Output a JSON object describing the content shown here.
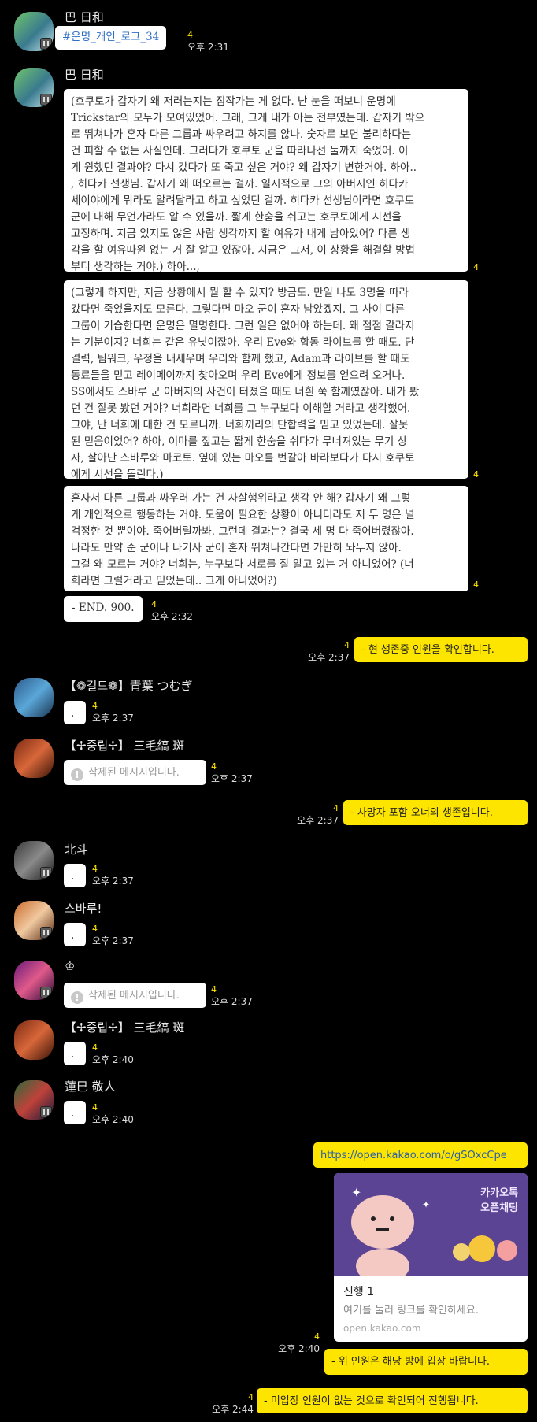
{
  "unread_count": "4",
  "colors": {
    "background": "#000000",
    "mine_bubble": "#fee500",
    "other_bubble": "#ffffff",
    "link": "#2f70c5"
  },
  "messages": [
    {
      "sender": "巴 日和",
      "text": "#운명_개인_로그_34",
      "time": "오후 2:31"
    },
    {
      "sender": "巴 日和",
      "p1_lines": [
        "(호쿠토가 갑자기 왜 저러는지는 짐작가는 게 없다. 난 눈을 떠보니 운명에",
        "Trickstar의 모두가 모여있었어. 그래, 그게 내가 아는 전부였는데. 갑자기 밖으",
        "로 뛰쳐나가 혼자 다른 그룹과 싸우려고 하지를 않나. 숫자로 보면 불리하다는",
        "건 피할 수 없는 사실인데. 그러다가 호쿠토 군을 따라나선 둘까지 죽었어. 이",
        "게 원했던 결과야? 다시 갔다가 또 죽고 싶은 거야? 왜 갑자기 변한거야. 하아..",
        ", 히다카 선생님. 갑자기 왜 떠오르는 걸까. 일시적으로 그의 아버지인 히다카",
        "세이야에게 뭐라도 알려달라고 하고 싶었던 걸까. 히다카 선생님이라면 호쿠토",
        " 군에 대해 무언가라도 알 수 있을까. 짧게 한숨을 쉬고는 호쿠토에게 시선을",
        "고정하며. 지금 있지도 않은 사람 생각까지 할 여유가 내게 남아있어? 다른 생",
        "각을 할 여유따윈 없는 거 잘 알고 있잖아. 지금은 그저, 이 상황을 해결할 방법",
        "부터 생각하는 거야.) 하아...,"
      ],
      "p2_lines": [
        "(그렇게 하지만, 지금 상황에서 뭘 할 수 있지? 방금도. 만일 나도 3명을 따라",
        "갔다면 죽었을지도 모른다. 그렇다면 마오 군이 혼자 남았겠지. 그 사이 다른",
        "그룹이 기습한다면 운명은 멸명한다. 그런 일은 없어야 하는데. 왜 점점 갈라지",
        "는 기분이지? 너희는 같은 유닛이잖아. 우리 Eve와 합동 라이브를 할 때도. 단",
        "결력, 팀워크, 우정을 내세우며 우리와 함께 했고, Adam과 라이브를 할 때도",
        "동료들을 믿고 레이메이까지 찾아오며 우리 Eve에게 정보를 얻으려 오거나.",
        "SS에서도 스바루 군 아버지의 사건이 터졌을 때도 너흰 쭉 함께였잖아. 내가 봤",
        "던 건 잘못 봤던 거야? 너희라면 너희를 그 누구보다 이해할 거라고 생각했어.",
        "그야, 난 너희에 대한 건 모르니까. 너희끼리의 단합력을 믿고 있었는데. 잘못",
        "된 믿음이었어? 하아, 이마를 짚고는 짧게 한숨을 쉬다가 무너져있는 무기 상",
        "자, 살아난 스바루와 마코토. 옆에 있는 마오를 번갈아 바라보다가 다시 호쿠토",
        "에게 시선을 돌린다.)"
      ],
      "p3_lines": [
        "혼자서 다른 그룹과 싸우러 가는 건 자살행위라고 생각 안 해? 갑자기 왜 그렇",
        "게 개인적으로 행동하는 거야. 도움이 필요한 상황이 아니더라도 저 두 명은 널",
        " 걱정한 것 뿐이야. 죽어버릴까봐. 그런데 결과는? 결국 세 명 다 죽어버렸잖아.",
        " 나라도 만약 준 군이나 나기사 군이 혼자 뛰쳐나간다면 가만히 놔두지 않아.",
        "그걸 왜 모르는 거야? 너희는, 누구보다 서로를 잘 알고 있는 거 아니었어? (너",
        "희라면 그럴거라고 믿었는데.. 그게 아니었어?)"
      ],
      "p4": "- END. 900.",
      "time": "오후 2:32"
    },
    {
      "mine": true,
      "text": "- 현 생존중 인원을 확인합니다.",
      "time": "오후 2:37"
    },
    {
      "sender": "【❁길드❁】青葉 つむぎ",
      "text": ".",
      "time": "오후 2:37"
    },
    {
      "sender": "【✢중립✢】 三毛縞 斑",
      "text": "삭제된 메시지입니다.",
      "deleted": true,
      "time": "오후 2:37"
    },
    {
      "mine": true,
      "text": "- 사망자 포함 오너의 생존입니다.",
      "time": "오후 2:37"
    },
    {
      "sender": "北斗",
      "text": ".",
      "time": "오후 2:37"
    },
    {
      "sender": "스바루!",
      "text": ".",
      "time": "오후 2:37"
    },
    {
      "sender": "♔",
      "text": "삭제된 메시지입니다.",
      "deleted": true,
      "time": "오후 2:37"
    },
    {
      "sender": "【✢중립✢】 三毛縞 斑",
      "text": ".",
      "time": "오후 2:40"
    },
    {
      "sender": "蓮巳 敬人",
      "text": ".",
      "time": "오후 2:40"
    },
    {
      "mine": true,
      "link": "https://open.kakao.com/o/gSOxcCpe",
      "card": {
        "badge_line1": "카카오톡",
        "badge_line2": "오픈채팅",
        "title": "진행 1",
        "desc": "여기를 눌러 링크를 확인하세요.",
        "domain": "open.kakao.com"
      }
    },
    {
      "mine": true,
      "text": "- 위 인원은 해당 방에 입장 바랍니다.",
      "time": "오후 2:40"
    },
    {
      "mine": true,
      "text": "- 미입장 인원이 없는 것으로 확인되어 진행됩니다.",
      "time": "오후 2:44"
    }
  ]
}
